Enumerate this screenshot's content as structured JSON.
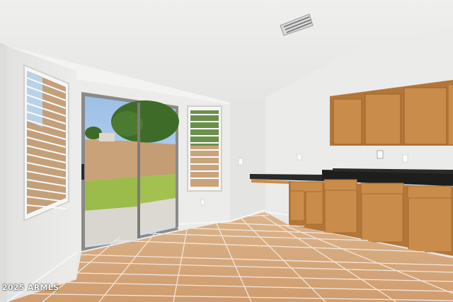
{
  "photo": {
    "watermark": "2025 ARMLS",
    "colors": {
      "ceiling": "#eeeeec",
      "wall": "#eaeaea",
      "cabinet": "#c98c4a",
      "countertop": "#1e1e1e",
      "floor_tile": "#d4a57a",
      "grout": "#f2e6da",
      "sky": "#a8c8ea",
      "fence": "#c9a27a",
      "lawn": "#9bbb4a"
    }
  }
}
